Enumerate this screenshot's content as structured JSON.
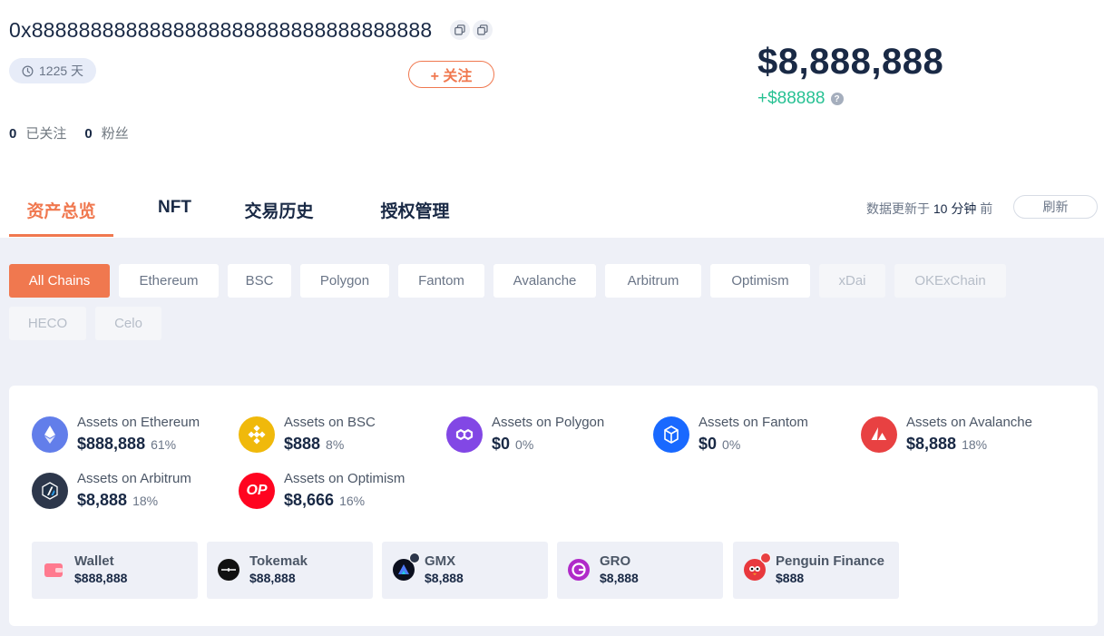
{
  "profile": {
    "address": "0x8888888888888888888888888888888888",
    "days": "1225 天",
    "follow_label": "+ 关注",
    "following_count": "0",
    "following_label": "已关注",
    "followers_count": "0",
    "followers_label": "粉丝"
  },
  "balance": {
    "total": "$8,888,888",
    "change": "+$88888",
    "help": "?"
  },
  "tabs": [
    {
      "label": "资产总览",
      "active": true
    },
    {
      "label": "NFT"
    },
    {
      "label": "交易历史"
    },
    {
      "label": "授权管理"
    }
  ],
  "update": {
    "prefix": "数据更新于",
    "time": "10 分钟",
    "suffix": "前",
    "refresh_label": "刷新"
  },
  "chain_filters": [
    {
      "label": "All Chains",
      "state": "active"
    },
    {
      "label": "Ethereum",
      "state": "normal"
    },
    {
      "label": "BSC",
      "state": "normal"
    },
    {
      "label": "Polygon",
      "state": "normal"
    },
    {
      "label": "Fantom",
      "state": "normal"
    },
    {
      "label": "Avalanche",
      "state": "normal"
    },
    {
      "label": "Arbitrum",
      "state": "normal"
    },
    {
      "label": "Optimism",
      "state": "normal"
    },
    {
      "label": "xDai",
      "state": "disabled"
    },
    {
      "label": "OKExChain",
      "state": "disabled"
    },
    {
      "label": "HECO",
      "state": "disabled"
    },
    {
      "label": "Celo",
      "state": "disabled"
    }
  ],
  "chain_assets": [
    {
      "label": "Assets on Ethereum",
      "value": "$888,888",
      "pct": "61%",
      "icon": "ethereum-icon",
      "color": "#627eea"
    },
    {
      "label": "Assets on BSC",
      "value": "$888",
      "pct": "8%",
      "icon": "bsc-icon",
      "color": "#f0b90b"
    },
    {
      "label": "Assets on Polygon",
      "value": "$0",
      "pct": "0%",
      "icon": "polygon-icon",
      "color": "#8247e5"
    },
    {
      "label": "Assets on Fantom",
      "value": "$0",
      "pct": "0%",
      "icon": "fantom-icon",
      "color": "#1969ff"
    },
    {
      "label": "Assets on Avalanche",
      "value": "$8,888",
      "pct": "18%",
      "icon": "avalanche-icon",
      "color": "#e84142"
    },
    {
      "label": "Assets on Arbitrum",
      "value": "$8,888",
      "pct": "18%",
      "icon": "arbitrum-icon",
      "color": "#2d374b"
    },
    {
      "label": "Assets on Optimism",
      "value": "$8,666",
      "pct": "16%",
      "icon": "optimism-icon",
      "color": "#ff0420",
      "logo_text": "OP"
    }
  ],
  "protocols": [
    {
      "name": "Wallet",
      "value": "$888,888",
      "icon": "wallet-icon"
    },
    {
      "name": "Tokemak",
      "value": "$88,888",
      "icon": "tokemak-icon"
    },
    {
      "name": "GMX",
      "value": "$8,888",
      "icon": "gmx-icon"
    },
    {
      "name": "GRO",
      "value": "$8,888",
      "icon": "gro-icon"
    },
    {
      "name": "Penguin Finance",
      "value": "$888",
      "icon": "penguin-finance-icon"
    }
  ],
  "colors": {
    "accent": "#f0784f",
    "positive": "#27c193",
    "text": "#192945"
  }
}
